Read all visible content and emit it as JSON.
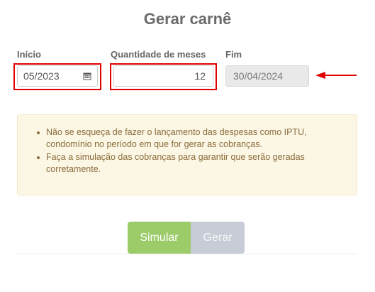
{
  "header": {
    "title": "Gerar carnê"
  },
  "form": {
    "inicio": {
      "label": "Início",
      "value": "05/2023",
      "icon": "calendar-icon"
    },
    "quantidade": {
      "label": "Quantidade de meses",
      "value": "12"
    },
    "fim": {
      "label": "Fim",
      "value": "30/04/2024"
    }
  },
  "notice": {
    "items": [
      "Não se esqueça de fazer o lançamento das despesas como IPTU, condomínio no período em que for gerar as cobranças.",
      "Faça a simulação das cobranças para garantir que serão geradas corretamente."
    ]
  },
  "actions": {
    "simular_label": "Simular",
    "gerar_label": "Gerar"
  },
  "colors": {
    "highlight": "#e00000",
    "simular": "#9ccc6a",
    "gerar": "#c7ccd6",
    "notice_bg": "#fcf6e5",
    "notice_text": "#8a6d3b"
  }
}
